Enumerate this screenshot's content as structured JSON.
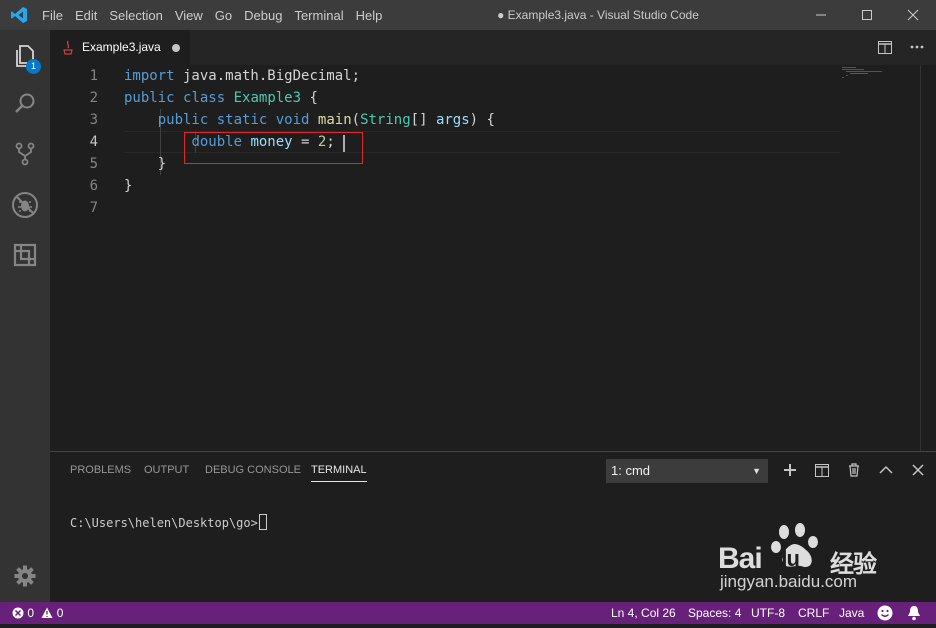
{
  "window": {
    "title": "● Example3.java - Visual Studio Code",
    "menu": [
      "File",
      "Edit",
      "Selection",
      "View",
      "Go",
      "Debug",
      "Terminal",
      "Help"
    ]
  },
  "activity_bar": {
    "explorer_badge": "1",
    "icons": [
      "files-icon",
      "search-icon",
      "source-control-icon",
      "debug-icon",
      "extensions-icon",
      "gear-icon"
    ]
  },
  "editor": {
    "tab": {
      "label": "Example3.java",
      "dirty": true
    },
    "lines": [
      {
        "n": "1",
        "tokens": [
          [
            "kw",
            "import"
          ],
          [
            "txt",
            " java.math.BigDecimal;"
          ]
        ]
      },
      {
        "n": "2",
        "tokens": [
          [
            "kw",
            "public"
          ],
          [
            "txt",
            " "
          ],
          [
            "kw",
            "class"
          ],
          [
            "txt",
            " "
          ],
          [
            "cls",
            "Example3"
          ],
          [
            "txt",
            " {"
          ]
        ]
      },
      {
        "n": "3",
        "tokens": [
          [
            "txt",
            "    "
          ],
          [
            "kw",
            "public"
          ],
          [
            "txt",
            " "
          ],
          [
            "kw",
            "static"
          ],
          [
            "txt",
            " "
          ],
          [
            "kw",
            "void"
          ],
          [
            "txt",
            " "
          ],
          [
            "fn",
            "main"
          ],
          [
            "txt",
            "("
          ],
          [
            "cls",
            "String"
          ],
          [
            "txt",
            "[] "
          ],
          [
            "var",
            "args"
          ],
          [
            "txt",
            ") {"
          ]
        ]
      },
      {
        "n": "4",
        "tokens": [
          [
            "txt",
            "        "
          ],
          [
            "kw",
            "double"
          ],
          [
            "txt",
            " "
          ],
          [
            "var",
            "money"
          ],
          [
            "txt",
            " = "
          ],
          [
            "num",
            "2"
          ],
          [
            "txt",
            ";"
          ]
        ]
      },
      {
        "n": "5",
        "tokens": [
          [
            "txt",
            "    }"
          ]
        ]
      },
      {
        "n": "6",
        "tokens": [
          [
            "txt",
            "}"
          ]
        ]
      },
      {
        "n": "7",
        "tokens": []
      }
    ]
  },
  "panel": {
    "tabs": [
      "PROBLEMS",
      "OUTPUT",
      "DEBUG CONSOLE",
      "TERMINAL"
    ],
    "active_tab": "TERMINAL",
    "terminal_select": "1: cmd",
    "terminal_prompt": "C:\\Users\\helen\\Desktop\\go>"
  },
  "status": {
    "errors": "0",
    "warnings": "0",
    "position": "Ln 4, Col 26",
    "spaces": "Spaces: 4",
    "encoding": "UTF-8",
    "eol": "CRLF",
    "language": "Java"
  },
  "watermark": {
    "logo": "Bai du 经验",
    "url": "jingyan.baidu.com"
  },
  "colors": {
    "statusbar": "#68217a",
    "accent": "#007acc",
    "highlight_box": "#e0282b"
  }
}
